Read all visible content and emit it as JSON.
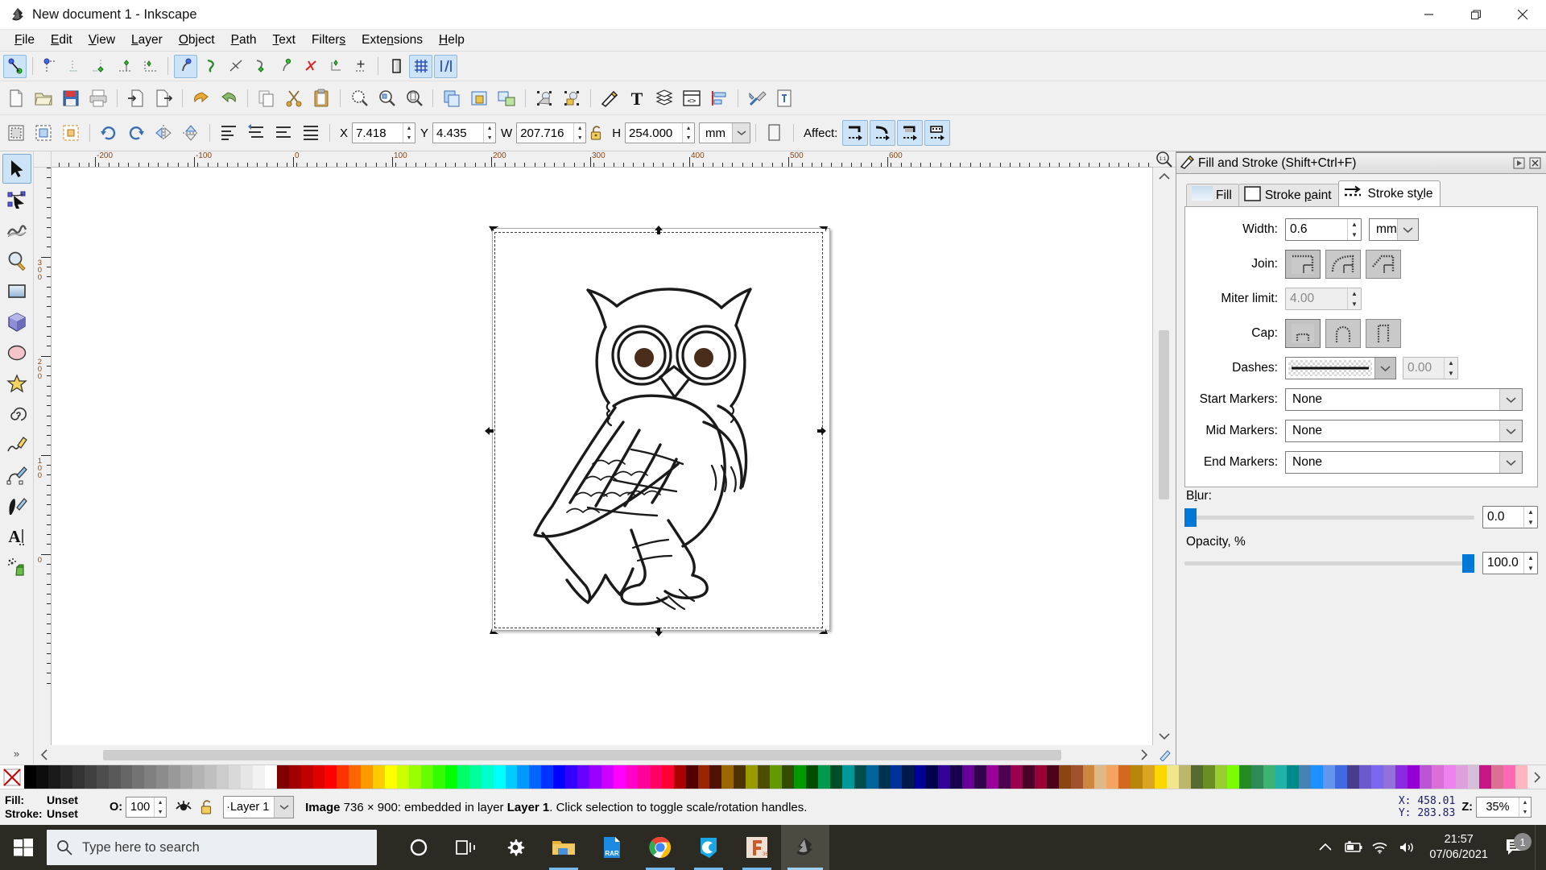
{
  "window": {
    "title": "New document 1 - Inkscape",
    "app_icon": "inkscape-icon",
    "minimize_label": "Minimize",
    "maximize_label": "Restore",
    "close_label": "Close"
  },
  "menubar": [
    {
      "label": "File",
      "accel": "F"
    },
    {
      "label": "Edit",
      "accel": "E"
    },
    {
      "label": "View",
      "accel": "V"
    },
    {
      "label": "Layer",
      "accel": "L"
    },
    {
      "label": "Object",
      "accel": "O"
    },
    {
      "label": "Path",
      "accel": "P"
    },
    {
      "label": "Text",
      "accel": "T"
    },
    {
      "label": "Filters",
      "accel": "s"
    },
    {
      "label": "Extensions",
      "accel": "n"
    },
    {
      "label": "Help",
      "accel": "H"
    }
  ],
  "snap_toolbar": {
    "items": [
      {
        "name": "enable-snapping",
        "active": true
      },
      {
        "name": "snap-bounding-boxes",
        "active": false
      },
      {
        "name": "snap-bbox-edges",
        "active": false
      },
      {
        "name": "snap-bbox-corners",
        "active": false
      },
      {
        "name": "snap-bbox-edge-midpoints",
        "active": false
      },
      {
        "name": "snap-bbox-centers",
        "active": false
      },
      {
        "name": "snap-nodes-paths",
        "active": true
      },
      {
        "name": "snap-paths",
        "active": false
      },
      {
        "name": "snap-path-intersections",
        "active": false
      },
      {
        "name": "snap-cusp-nodes",
        "active": false
      },
      {
        "name": "snap-smooth-nodes",
        "active": false
      },
      {
        "name": "snap-line-midpoints",
        "active": false
      },
      {
        "name": "snap-object-midpoints",
        "active": false
      },
      {
        "name": "snap-object-rotation-centers",
        "active": false
      },
      {
        "name": "snap-page-border",
        "active": false
      },
      {
        "name": "snap-grids",
        "active": true
      },
      {
        "name": "snap-guides",
        "active": true
      }
    ]
  },
  "command_toolbar": {
    "items": [
      {
        "name": "new-document-button",
        "icon": "new-page-icon"
      },
      {
        "name": "open-document-button",
        "icon": "folder-open-icon"
      },
      {
        "name": "save-document-button",
        "icon": "floppy-save-icon"
      },
      {
        "name": "print-document-button",
        "icon": "printer-icon"
      },
      {
        "name": "import-button",
        "icon": "import-arrow-icon"
      },
      {
        "name": "export-button",
        "icon": "export-arrow-icon"
      },
      {
        "name": "undo-button",
        "icon": "undo-arrow-icon"
      },
      {
        "name": "redo-button",
        "icon": "redo-arrow-icon"
      },
      {
        "name": "copy-button",
        "icon": "copy-icon"
      },
      {
        "name": "cut-button",
        "icon": "scissors-icon"
      },
      {
        "name": "paste-button",
        "icon": "clipboard-icon"
      },
      {
        "name": "zoom-selection-button",
        "icon": "zoom-selection-icon"
      },
      {
        "name": "zoom-drawing-button",
        "icon": "zoom-drawing-icon"
      },
      {
        "name": "zoom-page-button",
        "icon": "zoom-page-icon"
      },
      {
        "name": "duplicate-button",
        "icon": "duplicate-icon"
      },
      {
        "name": "group-button",
        "icon": "group-icon"
      },
      {
        "name": "ungroup-button",
        "icon": "ungroup-icon"
      },
      {
        "name": "clone-button",
        "icon": "clone-icon"
      },
      {
        "name": "unlink-clone-button",
        "icon": "unlink-clone-icon"
      },
      {
        "name": "fill-stroke-dialog-button",
        "icon": "pen-fill-icon"
      },
      {
        "name": "text-dialog-button",
        "icon": "text-T-icon"
      },
      {
        "name": "layers-dialog-button",
        "icon": "layers-stack-icon"
      },
      {
        "name": "xml-editor-button",
        "icon": "xml-code-icon"
      },
      {
        "name": "align-dialog-button",
        "icon": "align-icon"
      },
      {
        "name": "preferences-button",
        "icon": "tools-wrench-icon"
      },
      {
        "name": "document-properties-button",
        "icon": "document-properties-icon"
      }
    ]
  },
  "selector_toolbar": {
    "buttons": [
      {
        "name": "select-all-button",
        "icon": "select-all-icon"
      },
      {
        "name": "select-all-in-layers-button",
        "icon": "select-all-layers-icon"
      },
      {
        "name": "deselect-button",
        "icon": "deselect-icon"
      },
      {
        "name": "rotate-ccw-button",
        "icon": "rotate-ccw-icon"
      },
      {
        "name": "rotate-cw-button",
        "icon": "rotate-cw-icon"
      },
      {
        "name": "flip-horizontal-button",
        "icon": "flip-horizontal-icon"
      },
      {
        "name": "flip-vertical-button",
        "icon": "flip-vertical-icon"
      },
      {
        "name": "raise-to-top-button",
        "icon": "raise-top-icon"
      },
      {
        "name": "raise-button",
        "icon": "raise-icon"
      },
      {
        "name": "lower-button",
        "icon": "lower-icon"
      },
      {
        "name": "lower-to-bottom-button",
        "icon": "lower-bottom-icon"
      }
    ],
    "x": {
      "label": "X",
      "value": "7.418"
    },
    "y": {
      "label": "Y",
      "value": "4.435"
    },
    "w": {
      "label": "W",
      "value": "207.716"
    },
    "h": {
      "label": "H",
      "value": "254.000"
    },
    "lock_ratio": {
      "name": "lock-aspect-ratio-toggle",
      "locked": false
    },
    "units": "mm",
    "affect": {
      "label": "Affect:",
      "toggles": [
        {
          "name": "affect-stroke-width-toggle",
          "active": true
        },
        {
          "name": "affect-rounded-corners-toggle",
          "active": true
        },
        {
          "name": "affect-gradients-toggle",
          "active": true
        },
        {
          "name": "affect-patterns-toggle",
          "active": true
        }
      ]
    }
  },
  "toolbox": {
    "tools": [
      {
        "name": "selector-tool",
        "icon": "arrow-cursor-icon",
        "active": true
      },
      {
        "name": "node-tool",
        "icon": "node-editor-icon",
        "active": false
      },
      {
        "name": "tweak-tool",
        "icon": "tweak-wave-icon",
        "active": false
      },
      {
        "name": "zoom-tool",
        "icon": "magnifier-icon",
        "active": false
      },
      {
        "name": "rectangle-tool",
        "icon": "rectangle-icon",
        "active": false
      },
      {
        "name": "3dbox-tool",
        "icon": "cube-3d-icon",
        "active": false
      },
      {
        "name": "ellipse-tool",
        "icon": "ellipse-icon",
        "active": false
      },
      {
        "name": "star-tool",
        "icon": "star-icon",
        "active": false
      },
      {
        "name": "spiral-tool",
        "icon": "spiral-icon",
        "active": false
      },
      {
        "name": "pencil-tool",
        "icon": "pencil-icon",
        "active": false
      },
      {
        "name": "bezier-tool",
        "icon": "bezier-pen-icon",
        "active": false
      },
      {
        "name": "calligraphy-tool",
        "icon": "calligraphy-pen-icon",
        "active": false
      },
      {
        "name": "text-tool",
        "icon": "text-A-icon",
        "active": false
      },
      {
        "name": "spray-tool",
        "icon": "spray-can-icon",
        "active": false
      }
    ],
    "overflow_label": "»"
  },
  "rulers": {
    "horizontal_labels": [
      "-200",
      "-100",
      "0",
      "100",
      "200",
      "300",
      "400",
      "500",
      "600"
    ],
    "vertical_labels": [
      "300",
      "200",
      "100",
      "0"
    ]
  },
  "canvas": {
    "zoom_1to1_button": "zoom-1-to-1-icon",
    "drawing_name": "owl-line-drawing",
    "selection_handles_name": "selection-scale-handles"
  },
  "dock": {
    "title": "Fill and Stroke (Shift+Ctrl+F)",
    "title_icon": "fill-stroke-icon",
    "float_button": "float-dialog-icon",
    "close_button": "close-dialog-icon",
    "tabs": [
      {
        "label": "Fill",
        "icon": "fill-swatch-icon",
        "selected": false
      },
      {
        "label": "Stroke paint",
        "icon": "stroke-paint-icon",
        "selected": false,
        "accel": "p"
      },
      {
        "label": "Stroke style",
        "icon": "stroke-style-icon",
        "selected": true,
        "accel": "y"
      }
    ],
    "stroke_style": {
      "width": {
        "label": "Width:",
        "value": "0.6",
        "unit": "mm"
      },
      "join": {
        "label": "Join:",
        "options": [
          "miter-join",
          "round-join",
          "bevel-join"
        ],
        "selected": 0
      },
      "miter_limit": {
        "label": "Miter limit:",
        "value": "4.00",
        "disabled": true
      },
      "cap": {
        "label": "Cap:",
        "options": [
          "butt-cap",
          "round-cap",
          "square-cap"
        ],
        "selected": 0
      },
      "dashes": {
        "label": "Dashes:",
        "pattern": "solid",
        "offset": "0.00"
      },
      "start_markers": {
        "label": "Start Markers:",
        "value": "None"
      },
      "mid_markers": {
        "label": "Mid Markers:",
        "value": "None"
      },
      "end_markers": {
        "label": "End Markers:",
        "value": "None"
      }
    },
    "blur": {
      "label": "Blur:",
      "accel": "l",
      "value": "0.0",
      "percent": 0
    },
    "opacity": {
      "label": "Opacity, %",
      "value": "100.0",
      "percent": 100
    }
  },
  "palette": {
    "none_swatch_name": "no-color-swatch",
    "colors": [
      "#000000",
      "#0d0d0d",
      "#1a1a1a",
      "#262626",
      "#333333",
      "#404040",
      "#4d4d4d",
      "#595959",
      "#666666",
      "#737373",
      "#808080",
      "#8c8c8c",
      "#999999",
      "#a6a6a6",
      "#b3b3b3",
      "#bfbfbf",
      "#cccccc",
      "#d9d9d9",
      "#e6e6e6",
      "#f2f2f2",
      "#ffffff",
      "#800000",
      "#a00000",
      "#c00000",
      "#e00000",
      "#ff0000",
      "#ff3300",
      "#ff6600",
      "#ff9900",
      "#ffcc00",
      "#ffff00",
      "#ccff00",
      "#99ff00",
      "#66ff00",
      "#33ff00",
      "#00ff00",
      "#00ff66",
      "#00ff99",
      "#00ffcc",
      "#00ffff",
      "#00ccff",
      "#0099ff",
      "#0066ff",
      "#0033ff",
      "#0000ff",
      "#3300ff",
      "#6600ff",
      "#9900ff",
      "#cc00ff",
      "#ff00ff",
      "#ff00cc",
      "#ff0099",
      "#ff0066",
      "#ff0033",
      "#aa0000",
      "#550000",
      "#992600",
      "#4d1300",
      "#996600",
      "#4d3300",
      "#999900",
      "#4d4d00",
      "#669900",
      "#334d00",
      "#009900",
      "#004d00",
      "#00994d",
      "#004d26",
      "#009999",
      "#004d4d",
      "#006699",
      "#00334d",
      "#003399",
      "#00194d",
      "#000099",
      "#00004d",
      "#330099",
      "#19004d",
      "#660099",
      "#33004d",
      "#990099",
      "#4d004d",
      "#99004d",
      "#4d0026",
      "#990033",
      "#4d001a",
      "#8b4513",
      "#a0522d",
      "#cd853f",
      "#deb887",
      "#f4a460",
      "#d2691e",
      "#b8860b",
      "#daa520",
      "#ffd700",
      "#f0e68c",
      "#bdb76b",
      "#556b2f",
      "#6b8e23",
      "#9acd32",
      "#7cfc00",
      "#228b22",
      "#2e8b57",
      "#3cb371",
      "#20b2aa",
      "#008b8b",
      "#4682b4",
      "#1e90ff",
      "#6495ed",
      "#4169e1",
      "#483d8b",
      "#6a5acd",
      "#7b68ee",
      "#9370db",
      "#8a2be2",
      "#9400d3",
      "#ba55d3",
      "#da70d6",
      "#ee82ee",
      "#dda0dd",
      "#d8bfd8",
      "#c71585",
      "#db7093",
      "#ff69b4",
      "#ffb6c1"
    ]
  },
  "statusbar": {
    "fill_label": "Fill:",
    "fill_value": "Unset",
    "stroke_label": "Stroke:",
    "stroke_value": "Unset",
    "opacity_label": "O:",
    "opacity_value": "100",
    "hide_icon": "eye-hide-icon",
    "lock_icon": "unlock-layer-icon",
    "layer_value": "Layer 1",
    "message_prefix": "Image",
    "message_dims": "736 × 900",
    "message_mid": ": embedded in layer ",
    "message_layer": "Layer 1",
    "message_suffix": ". Click selection to toggle scale/rotation handles.",
    "coord_x_label": "X:",
    "coord_x": "458.01",
    "coord_y_label": "Y:",
    "coord_y": "283.83",
    "zoom_label": "Z:",
    "zoom_value": "35%"
  },
  "taskbar": {
    "start_name": "windows-start-button",
    "search_placeholder": "Type here to search",
    "search_icon": "search-magnifier-icon",
    "apps": [
      {
        "name": "cortana-button",
        "icon": "cortana-circle-icon",
        "open": false
      },
      {
        "name": "task-view-button",
        "icon": "task-view-icon",
        "open": false
      },
      {
        "name": "settings-taskbar-button",
        "icon": "gear-icon",
        "open": false
      },
      {
        "name": "file-explorer-taskbar-button",
        "icon": "folder-icon",
        "open": true
      },
      {
        "name": "winrar-taskbar-button",
        "icon": "rar-file-icon",
        "open": false
      },
      {
        "name": "chrome-taskbar-button",
        "icon": "chrome-icon",
        "open": true
      },
      {
        "name": "camtasia-taskbar-button",
        "icon": "camtasia-c-icon",
        "open": true
      },
      {
        "name": "fusion360-taskbar-button",
        "icon": "fusion360-icon",
        "open": true
      },
      {
        "name": "inkscape-taskbar-button",
        "icon": "inkscape-icon",
        "open": true,
        "active": true
      }
    ],
    "tray": [
      {
        "name": "show-hidden-icons-button",
        "icon": "chevron-up-icon"
      },
      {
        "name": "battery-status-icon",
        "icon": "battery-charging-icon"
      },
      {
        "name": "network-status-icon",
        "icon": "wifi-icon"
      },
      {
        "name": "volume-icon",
        "icon": "speaker-icon"
      }
    ],
    "clock_time": "21:57",
    "clock_date": "07/06/2021",
    "notification_icon": "notification-icon",
    "notification_count": "1"
  }
}
